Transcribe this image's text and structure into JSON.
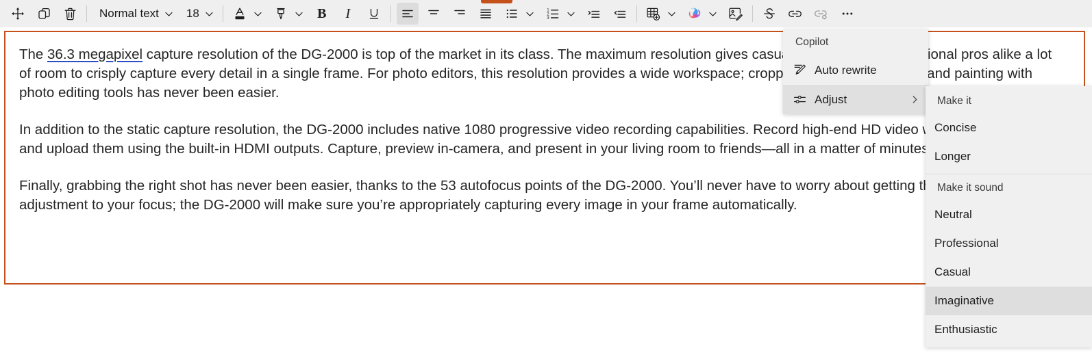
{
  "toolbar": {
    "move_label": "Move",
    "duplicate_label": "Duplicate",
    "delete_label": "Delete",
    "style_value": "Normal text",
    "font_size_value": "18",
    "font_color_label": "Font color",
    "highlight_label": "Text highlight color",
    "bold_label": "Bold",
    "italic_label": "Italic",
    "underline_label": "Underline",
    "align_left_label": "Align left",
    "align_center_label": "Align center",
    "align_right_label": "Align right",
    "justify_label": "Justify",
    "bulleted_list_label": "Bulleted list",
    "numbered_list_label": "Numbered list",
    "increase_indent_label": "Increase indent",
    "decrease_indent_label": "Decrease indent",
    "insert_table_label": "Insert table",
    "copilot_label": "Copilot",
    "edit_image_label": "Edit image",
    "strikethrough_label": "Strikethrough",
    "link_label": "Insert link",
    "unlink_label": "Remove link",
    "more_label": "More options"
  },
  "document": {
    "paragraphs": [
      {
        "prefix": "The ",
        "suggestion": "36.3 megapixel",
        "rest": " capture resolution of the DG-2000 is top of the market in its class. The maximum resolution gives casual shooters and professional pros alike a lot of room to crisply capture every detail in a single frame. For photo editors, this resolution provides a wide workspace; cropping, cloning, stamping, and painting with photo editing tools has never been easier."
      },
      {
        "prefix": "",
        "suggestion": "",
        "rest": "In addition to the static capture resolution, the DG-2000 includes native 1080 progressive video recording capabilities. Record high-end HD video with ease, and view and upload them using the built-in HDMI outputs. Capture, preview in-camera, and present in your living room to friends—all in a matter of minutes."
      },
      {
        "prefix": "",
        "suggestion": "",
        "rest": "Finally, grabbing the right shot has never been easier, thanks to the 53 autofocus points of the DG-2000. You’ll never have to worry about getting the perfect adjustment to your focus; the DG-2000 will make sure you’re appropriately capturing every image in your frame automatically."
      }
    ]
  },
  "copilot_menu": {
    "header": "Copilot",
    "items": [
      {
        "label": "Auto rewrite",
        "icon": "pen-rewrite-icon",
        "highlighted": false,
        "submenu": false
      },
      {
        "label": "Adjust",
        "icon": "sliders-icon",
        "highlighted": true,
        "submenu": true
      }
    ]
  },
  "adjust_submenu": {
    "group1_header": "Make it",
    "group1_items": [
      {
        "label": "Concise",
        "highlighted": false
      },
      {
        "label": "Longer",
        "highlighted": false
      }
    ],
    "group2_header": "Make it sound",
    "group2_items": [
      {
        "label": "Neutral",
        "highlighted": false
      },
      {
        "label": "Professional",
        "highlighted": false
      },
      {
        "label": "Casual",
        "highlighted": false
      },
      {
        "label": "Imaginative",
        "highlighted": true
      },
      {
        "label": "Enthusiastic",
        "highlighted": false
      }
    ]
  },
  "colors": {
    "accent_frame": "#c4501a",
    "toolbar_bg": "#efefef",
    "menu_bg": "#f0f0f0",
    "menu_highlight": "#dedede",
    "suggestion_underline": "#2b4ec4"
  }
}
